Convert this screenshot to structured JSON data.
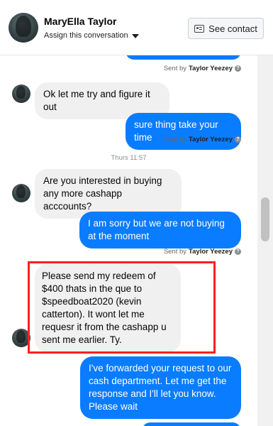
{
  "header": {
    "contact_name": "MaryElla Taylor",
    "assign_label": "Assign this conversation",
    "see_contact_label": "See contact"
  },
  "thread": {
    "sent_by_prefix": "Sent by",
    "agent_name": "Taylor Yeezey",
    "time_divider": "Thurs 11:57",
    "messages": [
      {
        "dir": "in",
        "text": "Ok  let me try and figure it out"
      },
      {
        "dir": "out",
        "text": "sure thing take your time"
      },
      {
        "dir": "in",
        "text": "Are you interested in buying any more cashapp acccounts?"
      },
      {
        "dir": "out",
        "text": "I am sorry but we are not buying at the moment"
      },
      {
        "dir": "in",
        "text": "Please send my redeem of $400 thats in the que to $speedboat2020 (kevin catterton). It wont let me requesr it from the cashapp u sent me earlier. Ty."
      },
      {
        "dir": "out",
        "text": "I've forwarded your request to our cash department. Let me get the response and I'll let you know. Please wait"
      }
    ]
  },
  "colors": {
    "outgoing_bubble": "#0a7cff",
    "incoming_bubble": "#f0f0f0",
    "highlight_box": "#ff1f1f"
  }
}
